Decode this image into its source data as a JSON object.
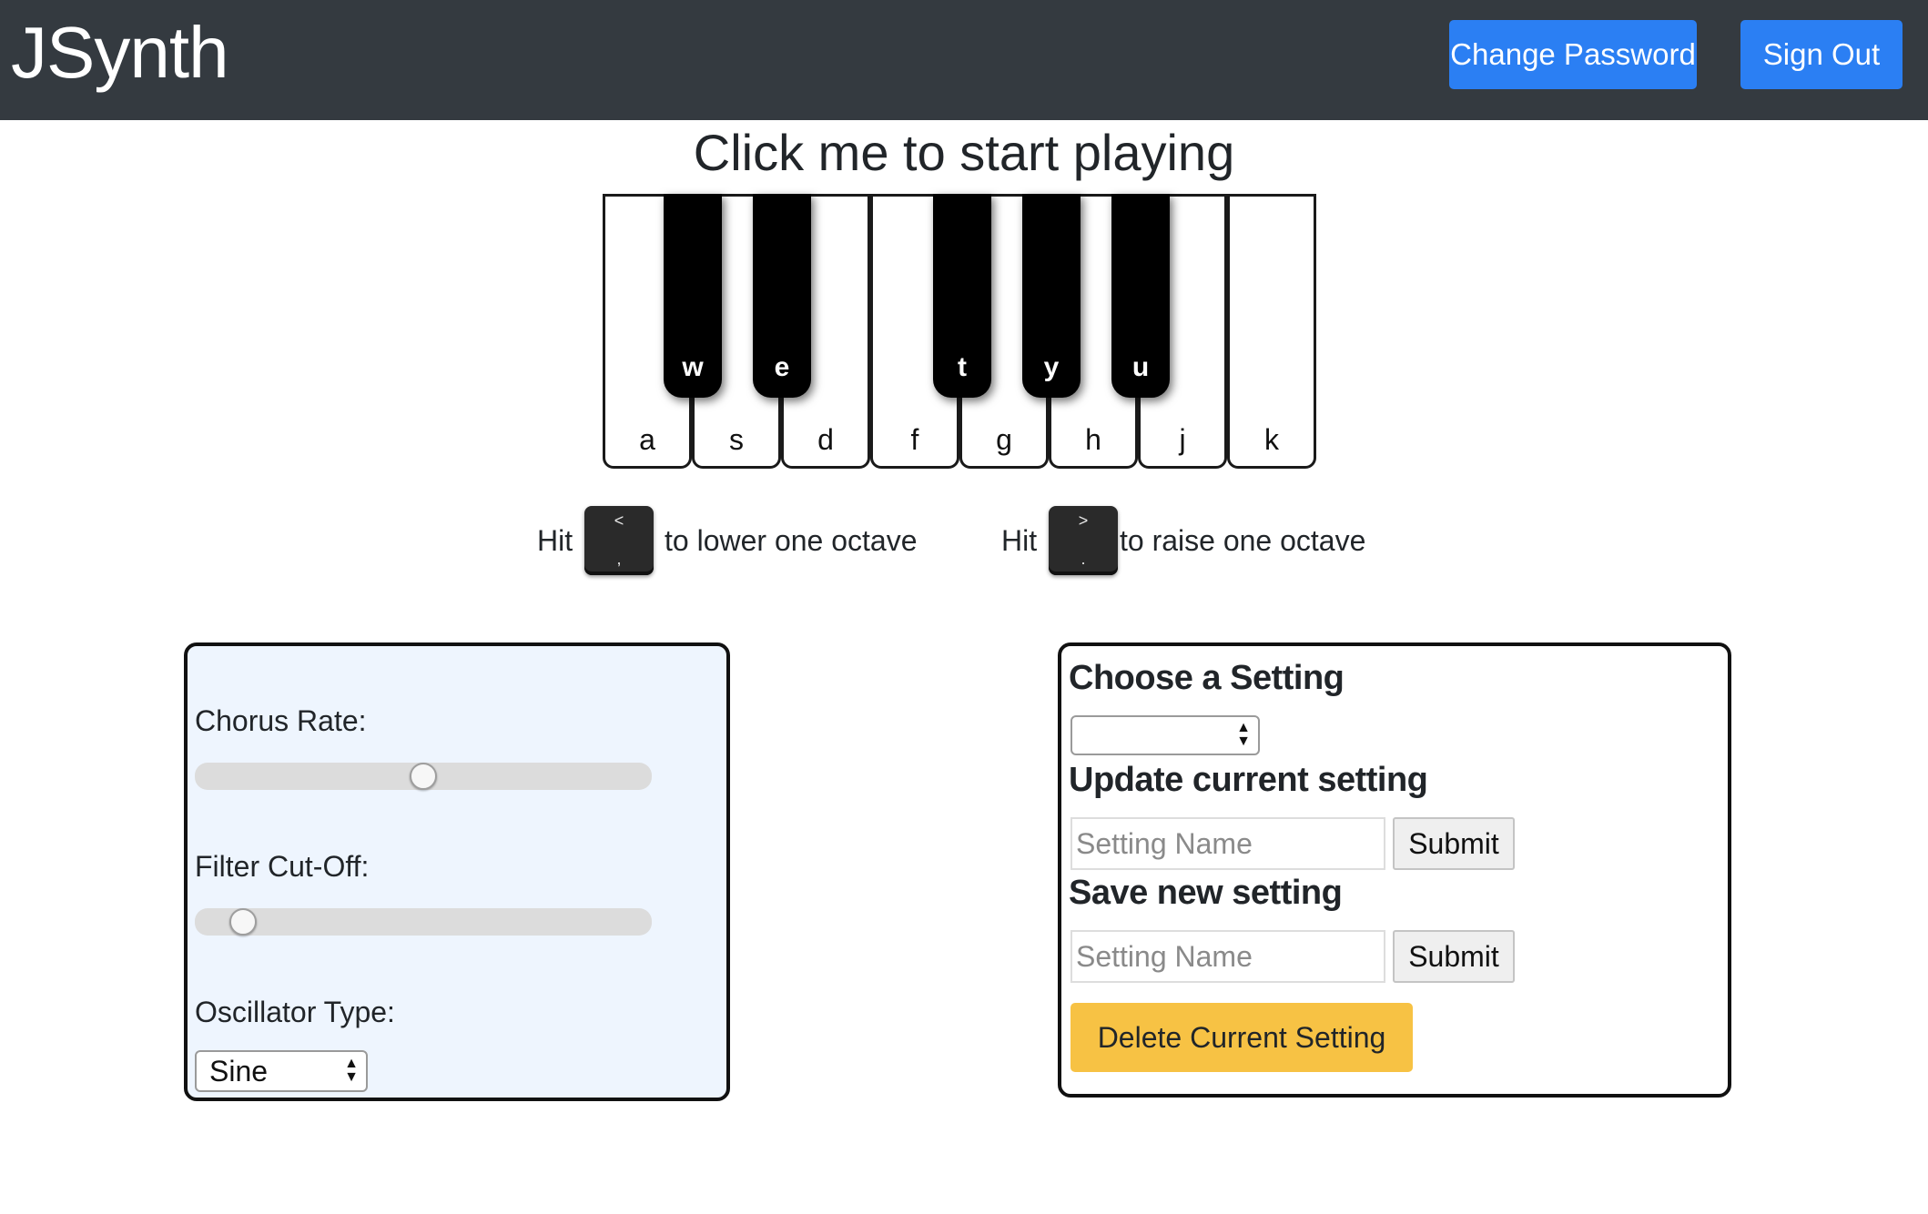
{
  "navbar": {
    "brand": "JSynth",
    "change_password_label": "Change Password",
    "sign_out_label": "Sign Out",
    "background": "#343a40",
    "button_color": "#2b7ff3"
  },
  "main": {
    "title": "Click me to start playing"
  },
  "piano": {
    "white_keys": [
      "a",
      "s",
      "d",
      "f",
      "g",
      "h",
      "j",
      "k"
    ],
    "black_keys": [
      "w",
      "e",
      "t",
      "y",
      "u"
    ]
  },
  "octave": {
    "lower_prefix": "Hit",
    "lower_text": "to lower one octave",
    "lower_key_top": "<",
    "lower_key_bottom": ",",
    "raise_prefix": "Hit",
    "raise_text": "to raise one octave",
    "raise_key_top": ">",
    "raise_key_bottom": "."
  },
  "controls": {
    "chorus_rate_label": "Chorus Rate:",
    "chorus_rate_fraction": 0.5,
    "filter_cutoff_label": "Filter Cut-Off:",
    "filter_cutoff_fraction": 0.08,
    "oscillator_type_label": "Oscillator Type:",
    "oscillator_type_value": "Sine",
    "panel_background": "#eef5fe"
  },
  "settings": {
    "choose_title": "Choose a Setting",
    "choose_value": "",
    "update_title": "Update current setting",
    "update_placeholder": "Setting Name",
    "update_submit": "Submit",
    "save_title": "Save new setting",
    "save_placeholder": "Setting Name",
    "save_submit": "Submit",
    "delete_label": "Delete Current Setting",
    "delete_color": "#f7c244"
  }
}
